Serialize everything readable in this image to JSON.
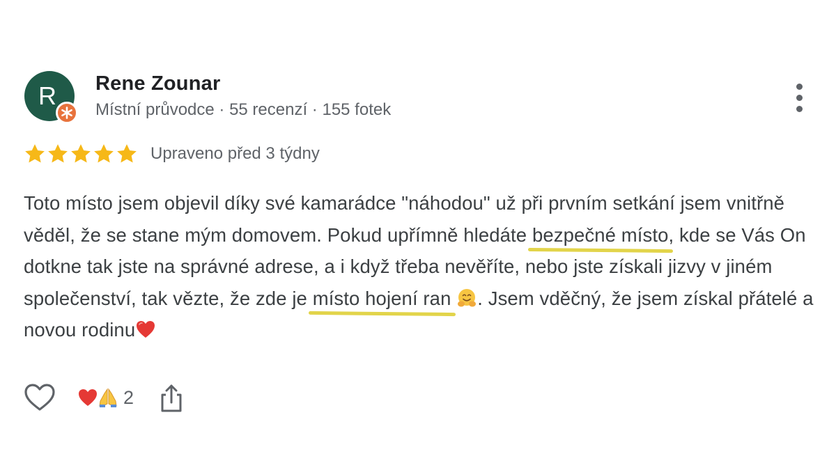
{
  "reviewer": {
    "avatar_letter": "R",
    "name": "Rene Zounar",
    "meta": "Místní průvodce · 55 recenzí · 155 fotek",
    "avatar_color": "#1f5a48",
    "badge_color": "#e8733d",
    "badge_icon": "local-guide-star-icon"
  },
  "rating": {
    "stars": 5,
    "star_color": "#f6b818",
    "edited": "Upraveno před 3 týdny"
  },
  "review": {
    "part1": "Toto místo jsem objevil díky své kamarádce \"náhodou\" už při prvním setkání jsem vnitřně věděl, že se stane mým domovem. Pokud upřímně hledáte ",
    "highlight1": "bezpečné místo",
    "part2": ", kde se Vás On dotkne tak jste na správné adrese, a i když třeba nevěříte, nebo jste získali jizvy v jiném společenství, tak vězte, že zde je ",
    "highlight2": "místo hojení ran",
    "part3": ". Jsem vděčný, že jsem získal přátelé a novou rodinu",
    "highlight_color": "#e2d44a",
    "emoji_after_highlight2": "hugging-face-emoji",
    "emoji_end": "red-heart-emoji"
  },
  "actions": {
    "like_icon": "heart-outline-icon",
    "reactions": [
      "red-heart-emoji",
      "folded-hands-emoji"
    ],
    "reaction_count": "2",
    "share_icon": "share-icon"
  },
  "more_icon": "more-vert-icon"
}
